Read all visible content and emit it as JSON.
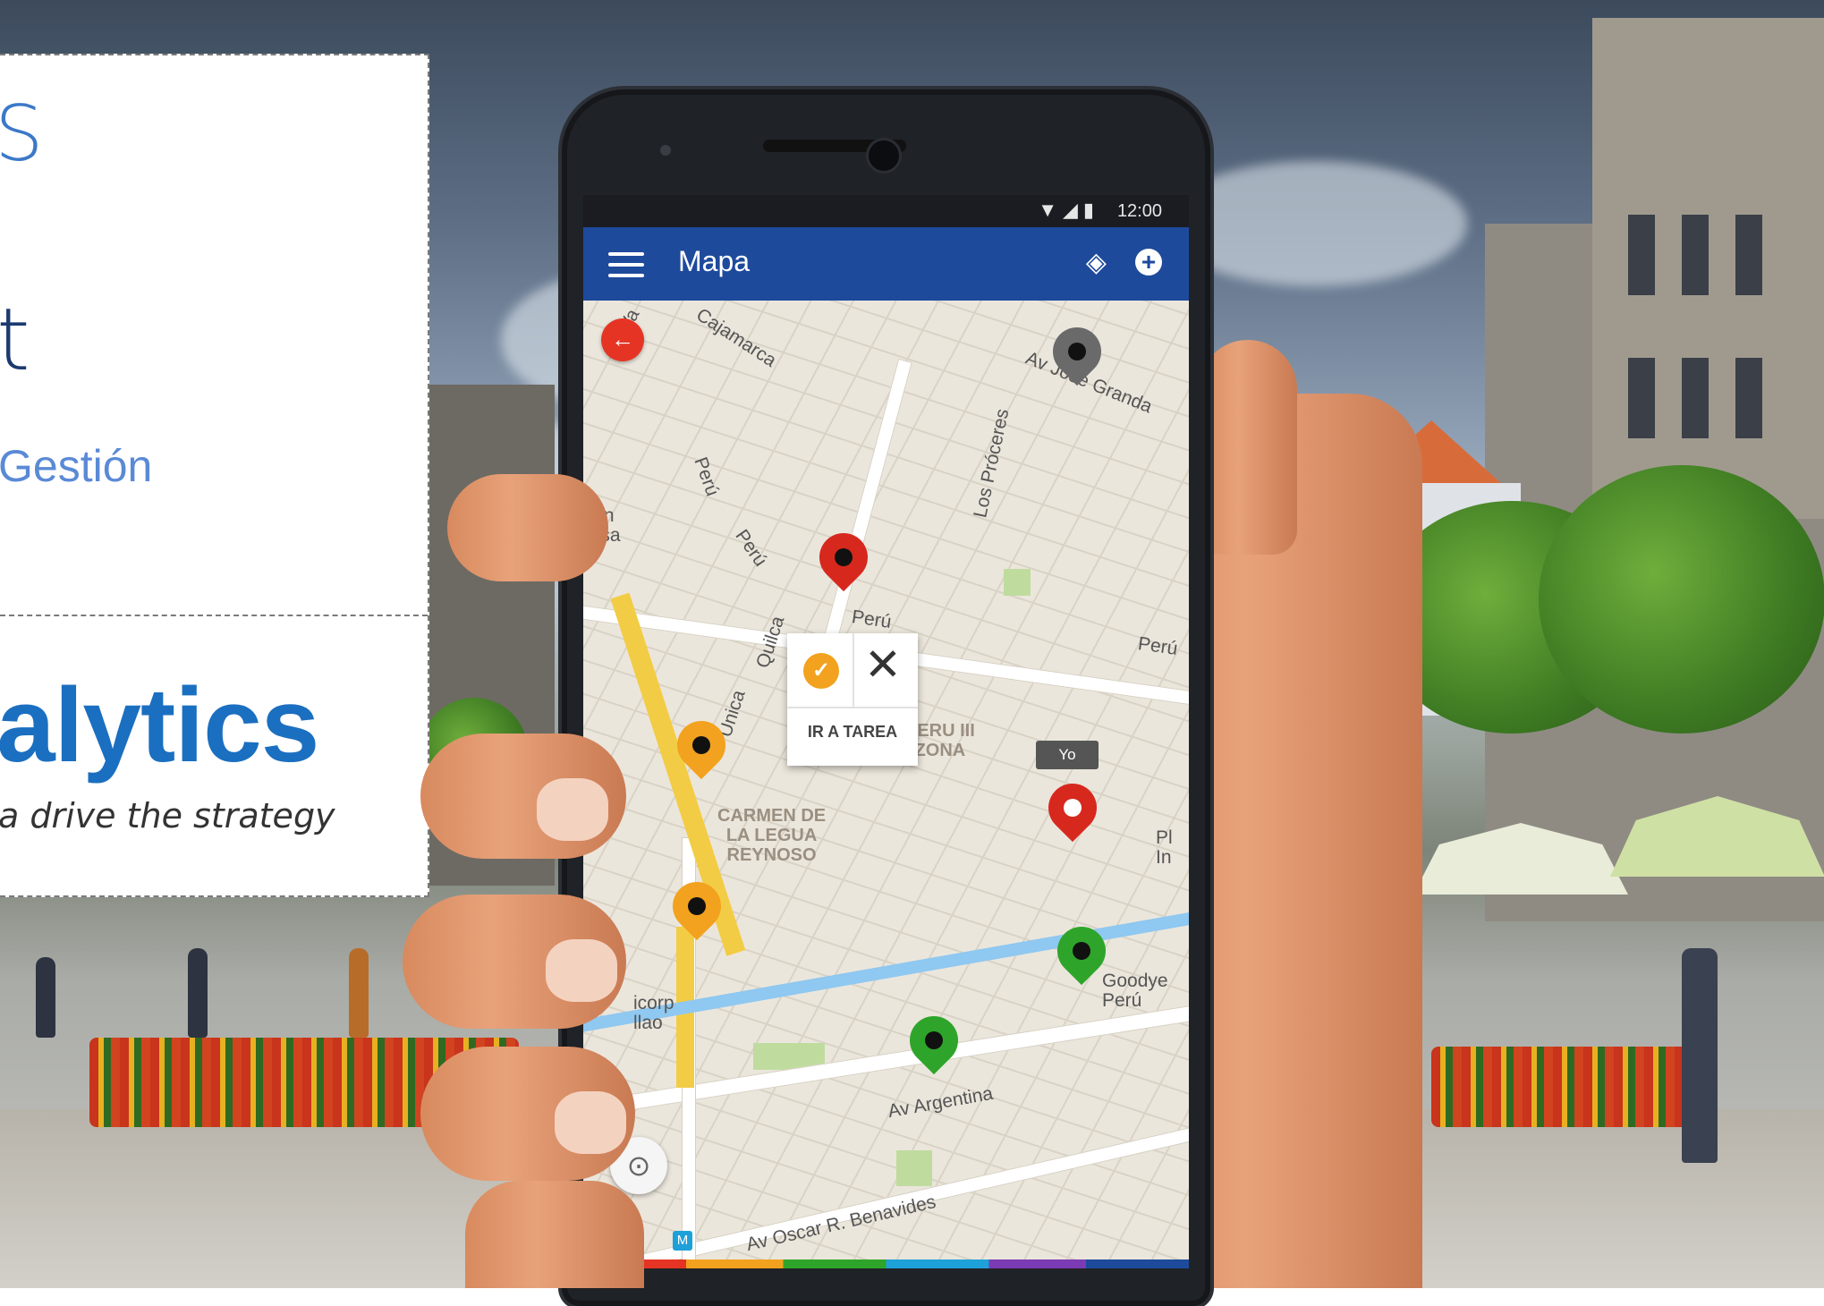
{
  "panel": {
    "title_fragment_top": "S",
    "title_fragment_mid": "t",
    "subtitle_fragment": "Gestión",
    "brand_fragment": "alytics",
    "tagline_fragment": "a drive the strategy"
  },
  "phone": {
    "status_time": "12:00",
    "status_icons": "▼◢▮",
    "app_title": "Mapa",
    "menu_icon": "hamburger-icon",
    "layers_icon": "layers-icon",
    "add_icon": "plus-circle-icon",
    "back_icon": "arrow-left-icon",
    "locate_icon": "target-icon"
  },
  "popup": {
    "confirm_icon": "check-icon",
    "close_glyph": "✕",
    "action_label": "IR A TAREA"
  },
  "map": {
    "streets": [
      "Cajamarca",
      "Av José Granda",
      "Los Próceres",
      "Perú",
      "Perú",
      "Perú",
      "Quilca",
      "Unica",
      "Av Argentina",
      "Av Oscar R. Benavides",
      "Perú",
      "Va"
    ],
    "areas": [
      "PERU III\nZONA",
      "CARMEN DE\nLA LEGUA\nREYNOSO"
    ],
    "places": [
      "ción\nnesa",
      "icorp\nllao",
      "Goodye\nPerú",
      "Pl\nIn"
    ],
    "user_tag": "Yo",
    "transit_badge": "M"
  },
  "colors": {
    "appbar": "#1e4a9c",
    "pin_red": "#d7281e",
    "pin_orange": "#f2a21e",
    "pin_green": "#2ea52a",
    "pin_gray": "#6a6a6a",
    "brand_blue": "#1b6fc0"
  }
}
